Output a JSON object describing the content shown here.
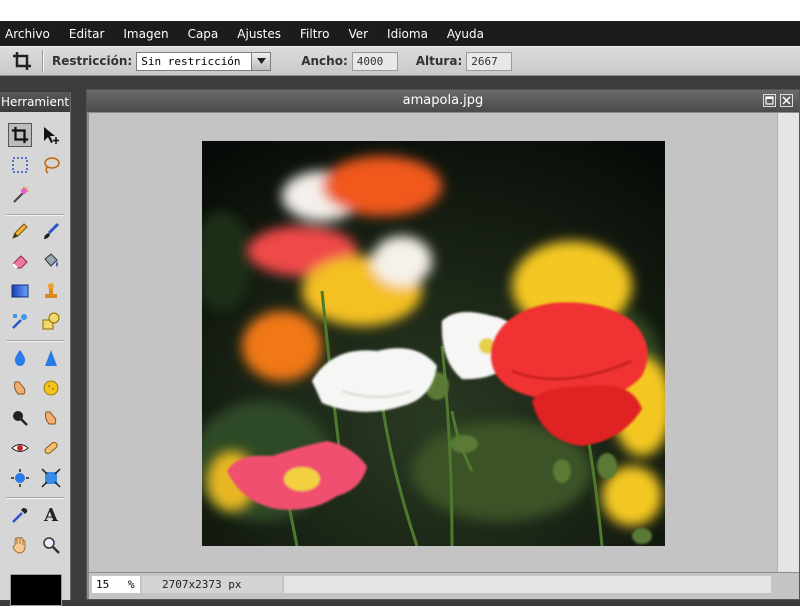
{
  "menu": {
    "items": [
      "Archivo",
      "Editar",
      "Imagen",
      "Capa",
      "Ajustes",
      "Filtro",
      "Ver",
      "Idioma",
      "Ayuda"
    ]
  },
  "options": {
    "restriction_label": "Restricción:",
    "restriction_value": "Sin restricción",
    "width_label": "Ancho:",
    "width_value": "4000",
    "height_label": "Altura:",
    "height_value": "2667"
  },
  "tools": {
    "title": "Herramientas"
  },
  "document": {
    "title": "amapola.jpg",
    "zoom_value": "15",
    "zoom_unit": "%",
    "dimensions": "2707x2373 px"
  },
  "colors": {
    "primary": "#000000",
    "menubar_bg": "#1c1c1c",
    "canvas_bg": "#c4c4c4"
  }
}
